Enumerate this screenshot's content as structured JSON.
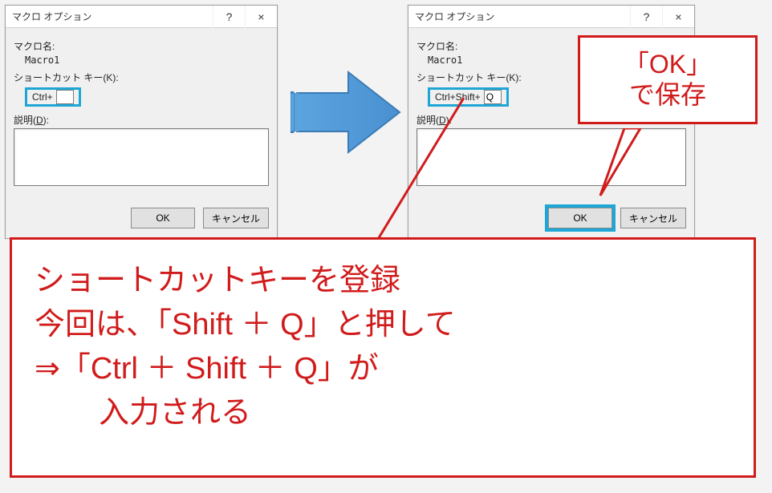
{
  "dialog_left": {
    "title": "マクロ オプション",
    "macro_label": "マクロ名:",
    "macro_name": "Macro1",
    "shortcut_label": "ショートカット キー(K):",
    "shortcut_prefix": "Ctrl+",
    "shortcut_value": "",
    "desc_label_pre": "説明(",
    "desc_label_u": "D",
    "desc_label_post": "):",
    "ok": "OK",
    "cancel": "キャンセル",
    "help": "?",
    "close": "×"
  },
  "dialog_right": {
    "title": "マクロ オプション",
    "macro_label": "マクロ名:",
    "macro_name": "Macro1",
    "shortcut_label": "ショートカット キー(K):",
    "shortcut_prefix": "Ctrl+Shift+",
    "shortcut_value": "Q",
    "desc_label_pre": "説明(",
    "desc_label_u": "D",
    "desc_label_post": "):",
    "ok": "OK",
    "cancel": "キャンセル",
    "help": "?",
    "close": "×"
  },
  "speech": {
    "line1": "「OK」",
    "line2": "で保存"
  },
  "instruction": {
    "line1": "ショートカットキーを登録",
    "line2": "今回は、「Shift ＋ Q」と押して",
    "line3": "⇒「Ctrl ＋ Shift ＋ Q」が",
    "line4": "入力される"
  }
}
